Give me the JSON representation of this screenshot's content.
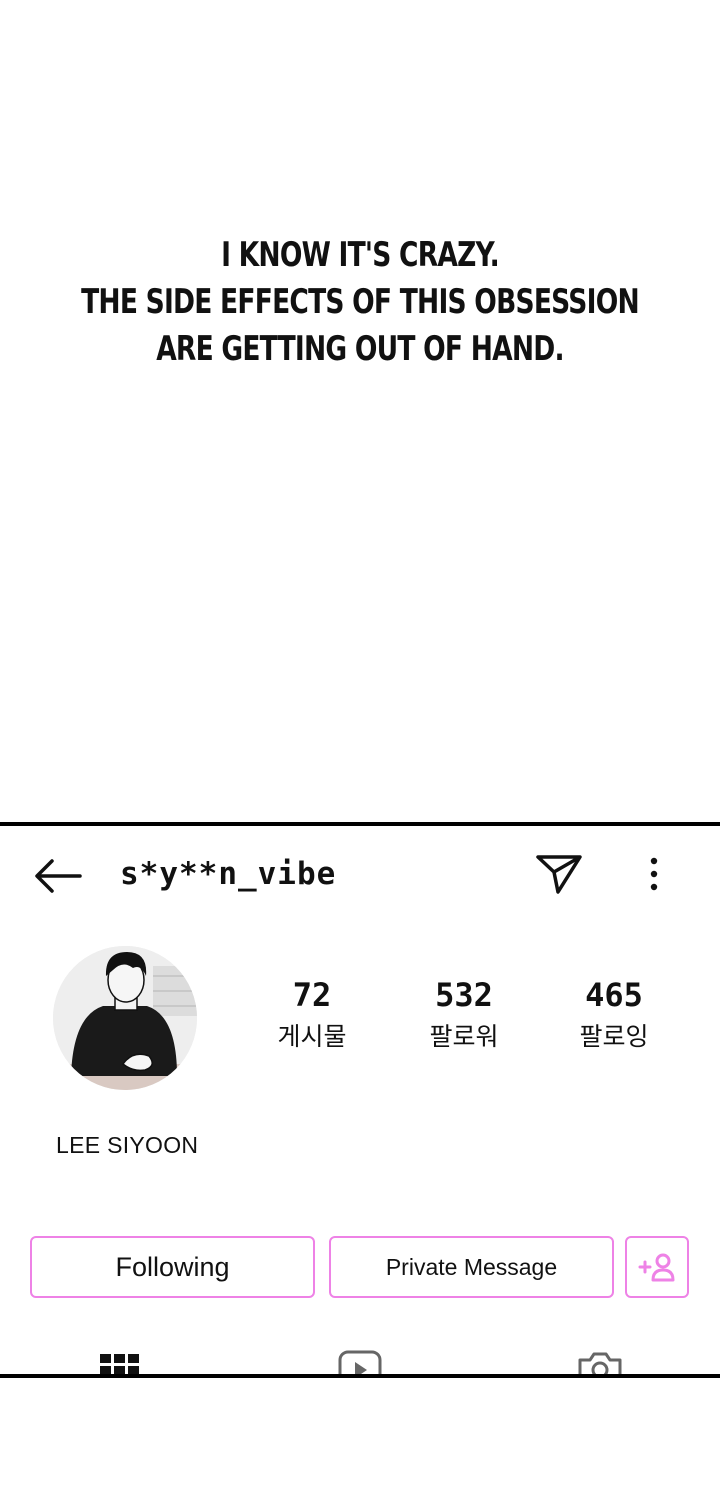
{
  "caption": {
    "lines": [
      "I KNOW IT'S CRAZY.",
      "THE SIDE EFFECTS OF THIS OBSESSION",
      "ARE GETTING OUT OF HAND."
    ]
  },
  "profile": {
    "username": "s*y**n_vibe",
    "display_name": "LEE SIYOON",
    "stats": [
      {
        "value": "72",
        "label": "게시물"
      },
      {
        "value": "532",
        "label": "팔로워"
      },
      {
        "value": "465",
        "label": "팔로잉"
      }
    ]
  },
  "buttons": {
    "following_label": "Following",
    "message_label": "Private Message"
  },
  "icons": {
    "back": "back-arrow-icon",
    "send": "send-icon",
    "more": "more-vertical-icon",
    "add_user": "add-user-icon",
    "grid": "grid-icon",
    "reels": "reels-icon",
    "tagged": "tagged-photos-icon"
  },
  "colors": {
    "accent_pink": "#ee82e6",
    "frame": "#000000"
  }
}
